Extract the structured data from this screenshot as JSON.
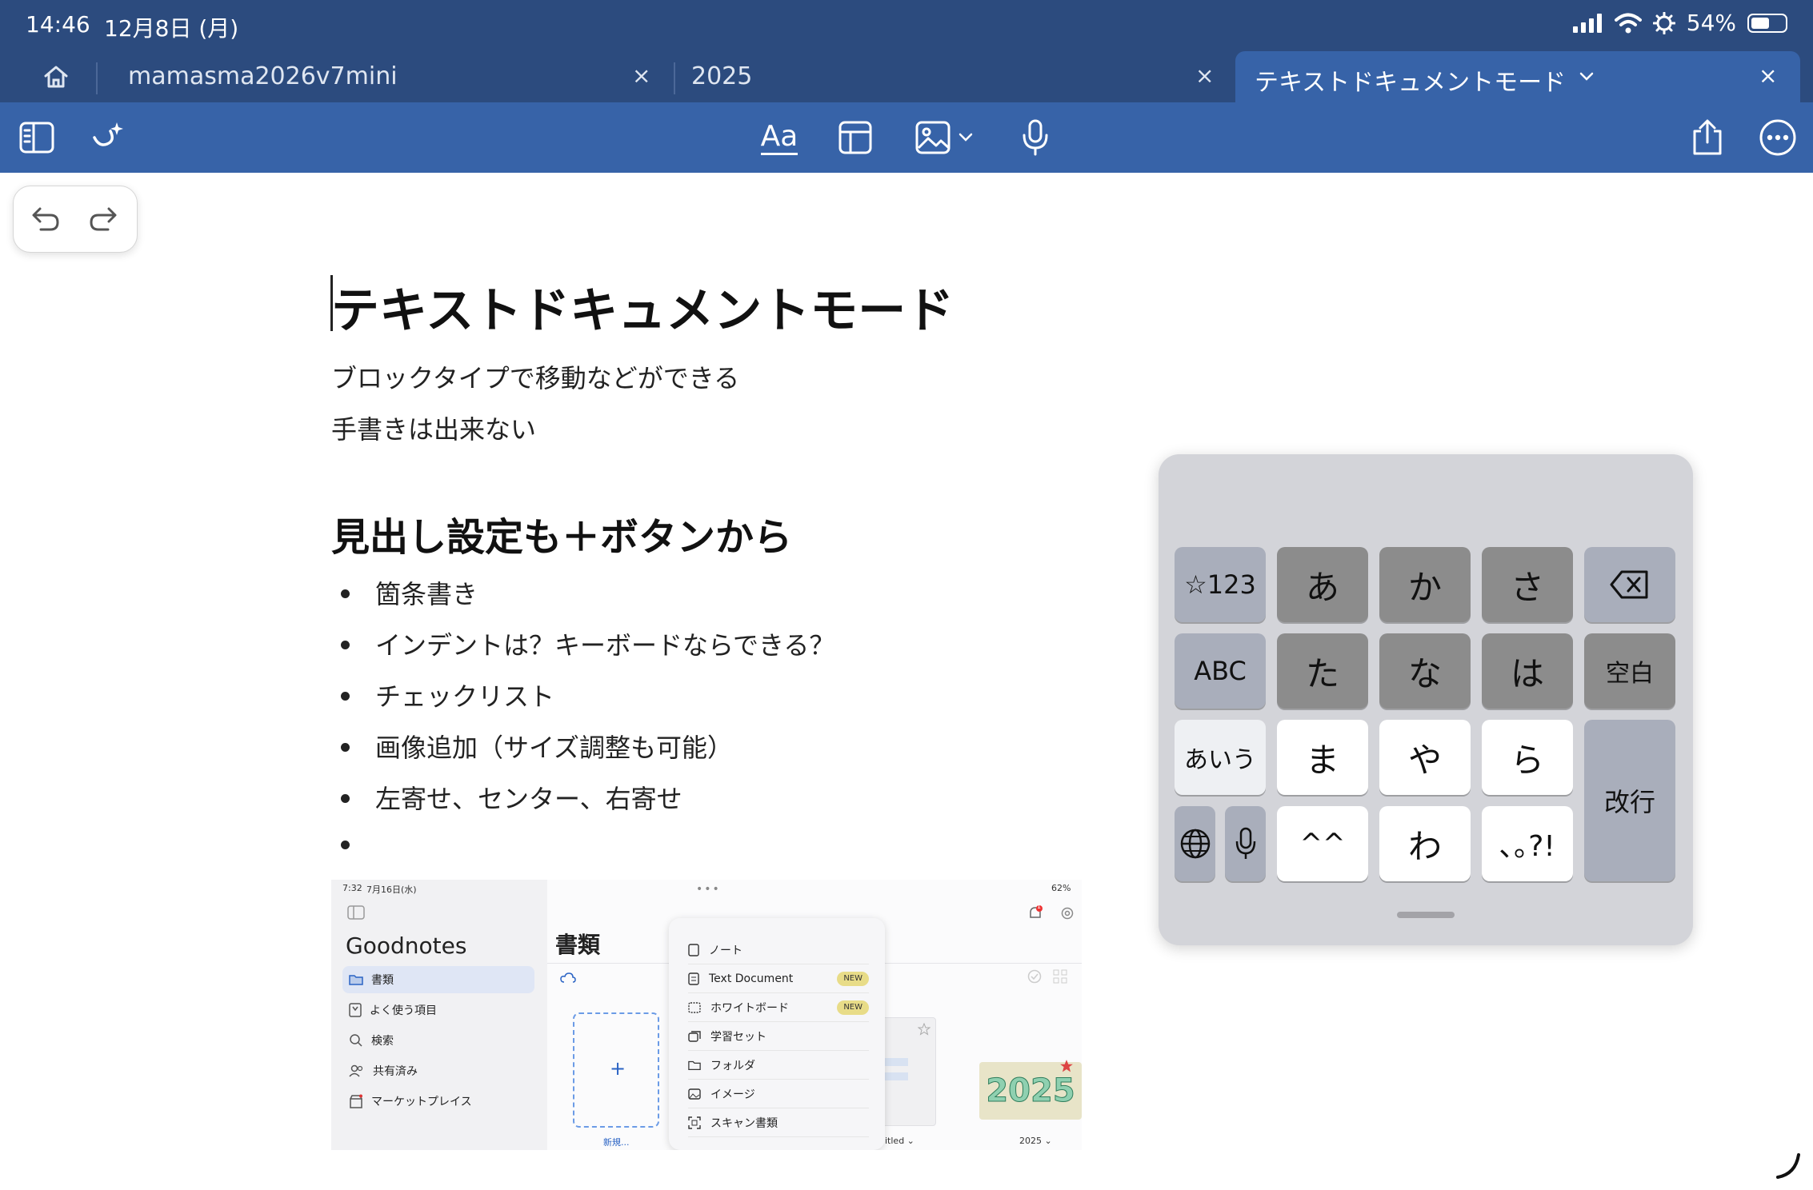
{
  "status_bar": {
    "time": "14:46",
    "date": "12月8日 (月)",
    "battery_percent": "54%",
    "battery_level": 0.54,
    "icons": [
      "signal-icon",
      "wifi-icon",
      "focus-icon",
      "battery-icon"
    ]
  },
  "tabs": [
    {
      "label": "mamasma2026v7mini",
      "active": false
    },
    {
      "label": "2025",
      "active": false
    },
    {
      "label": "テキストドキュメントモード",
      "active": true
    }
  ],
  "tab_close_glyph": "×",
  "toolbar": {
    "left_icons": [
      "sidebar-icon",
      "ai-assist-icon"
    ],
    "font_button_label": "Aa",
    "center_icons": [
      "text-format-icon",
      "table-icon",
      "image-icon",
      "microphone-icon"
    ],
    "right_icons": [
      "share-icon",
      "more-icon"
    ]
  },
  "document": {
    "title": "テキストドキュメントモード",
    "paragraphs": [
      "ブロックタイプで移動などができる",
      "手書きは出来ない"
    ],
    "heading": "見出し設定も＋ボタンから",
    "bullets": [
      "箇条書き",
      "インデントは？キーボードならできる？",
      "チェックリスト",
      "画像追加（サイズ調整も可能）",
      "左寄せ、センター、右寄せ",
      ""
    ]
  },
  "embedded_screenshot": {
    "status_time": "7:32",
    "status_date": "7月16日(水)",
    "status_battery": "62%",
    "app_title": "Goodnotes",
    "sidebar_items": [
      {
        "label": "書類",
        "icon": "folder-icon",
        "selected": true
      },
      {
        "label": "よく使う項目",
        "icon": "bookmark-icon",
        "selected": false
      },
      {
        "label": "検索",
        "icon": "search-icon",
        "selected": false
      },
      {
        "label": "共有済み",
        "icon": "people-icon",
        "selected": false
      },
      {
        "label": "マーケットプレイス",
        "icon": "store-icon",
        "selected": false
      }
    ],
    "main_title": "書類",
    "new_label": "新規...",
    "new_plus": "+",
    "menu_items": [
      {
        "label": "ノート",
        "badge": ""
      },
      {
        "label": "Text Document",
        "badge": "NEW"
      },
      {
        "label": "ホワイトボード",
        "badge": "NEW"
      },
      {
        "label": "学習セット",
        "badge": ""
      },
      {
        "label": "フォルダ",
        "badge": ""
      },
      {
        "label": "イメージ",
        "badge": ""
      },
      {
        "label": "スキャン書類",
        "badge": ""
      }
    ],
    "untitled_label": "itled ⌄",
    "year_label": "2025 ⌄",
    "year_art": "2025",
    "notification_count": "1"
  },
  "keyboard": {
    "rows": [
      [
        "☆123",
        "あ",
        "か",
        "さ",
        "⌫"
      ],
      [
        "ABC",
        "た",
        "な",
        "は",
        "空白"
      ],
      [
        "あいう",
        "ま",
        "や",
        "ら",
        "改行"
      ],
      [
        "🌐",
        "🎤",
        "^^",
        "わ",
        "､｡?!"
      ]
    ]
  }
}
